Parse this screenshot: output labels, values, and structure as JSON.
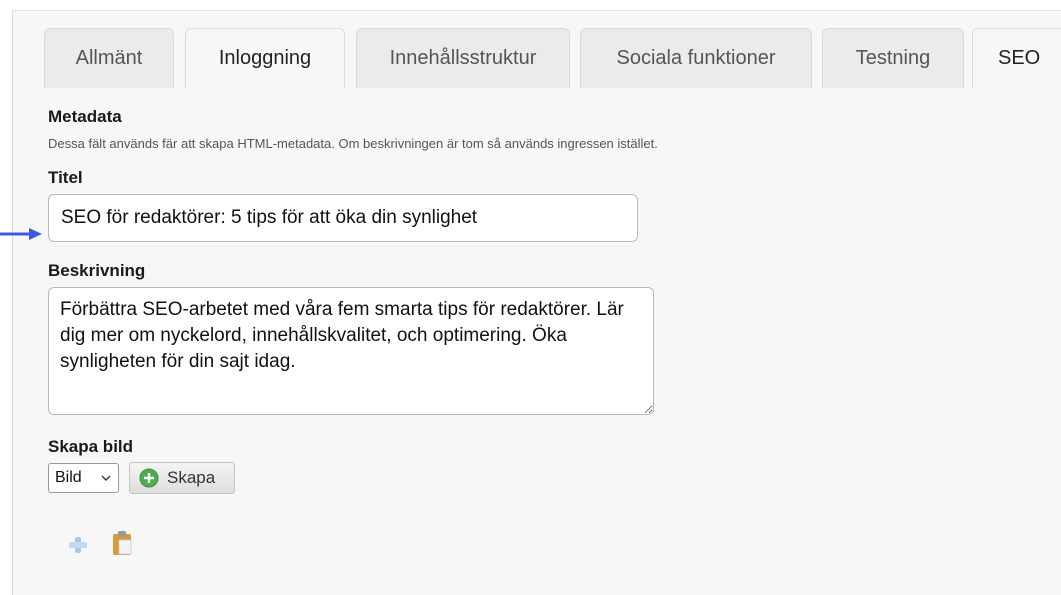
{
  "tabs": [
    {
      "label": "Allmänt"
    },
    {
      "label": "Inloggning"
    },
    {
      "label": "Innehållsstruktur"
    },
    {
      "label": "Sociala funktioner"
    },
    {
      "label": "Testning"
    },
    {
      "label": "SEO"
    }
  ],
  "metadata": {
    "heading": "Metadata",
    "help": "Dessa fält används fär att skapa HTML-metadata. Om beskrivningen är tom så används ingressen istället."
  },
  "title_field": {
    "label": "Titel",
    "value": "SEO för redaktörer: 5 tips för att öka din synlighet"
  },
  "description_field": {
    "label": "Beskrivning",
    "value": "Förbättra SEO-arbetet med våra fem smarta tips för redaktörer. Lär dig mer om nyckelord, innehållskvalitet, och optimering. Öka synligheten för din sajt idag."
  },
  "create_image": {
    "label": "Skapa bild",
    "select_value": "Bild",
    "button_label": "Skapa"
  },
  "icons": {
    "arrow": "pointer-arrow-icon",
    "add": "add-icon",
    "paste": "clipboard-icon",
    "chevron": "chevron-down-icon",
    "plus": "plus-circle-icon"
  },
  "colors": {
    "arrow": "#3b5bdb",
    "plus_green": "#4caf50"
  }
}
